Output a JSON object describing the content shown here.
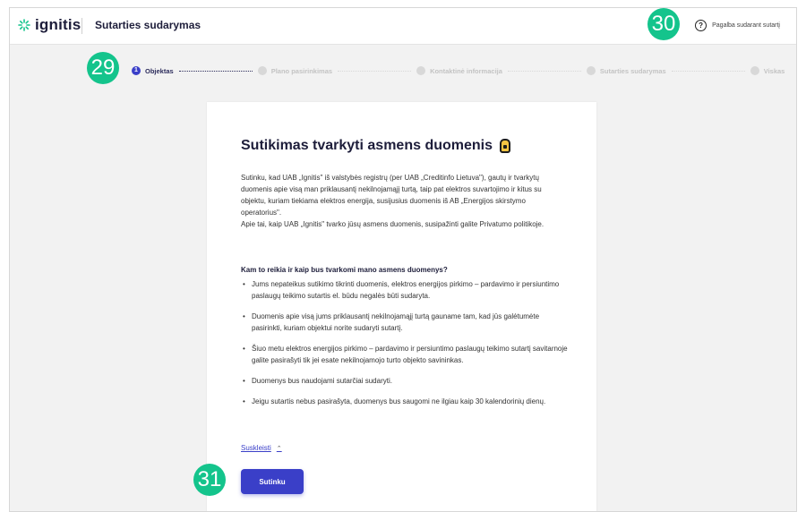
{
  "header": {
    "logo_text": "ignitis",
    "title": "Sutarties sudarymas",
    "help_label": "Pagalba sudarant sutartį",
    "help_icon": "question-circle-icon"
  },
  "markers": [
    "29",
    "30",
    "31"
  ],
  "stepper": {
    "steps": [
      {
        "number": "1",
        "label": "Objektas",
        "active": true
      },
      {
        "label": "Plano pasirinkimas"
      },
      {
        "label": "Kontaktinė informacija"
      },
      {
        "label": "Sutarties sudarymas"
      },
      {
        "label": "Viskas"
      }
    ]
  },
  "card": {
    "title": "Sutikimas tvarkyti asmens duomenis",
    "title_icon": "lock-icon",
    "paragraph": "Sutinku, kad UAB „Ignitis\" iš valstybės registrų (per UAB „Creditinfo Lietuva\"), gautų ir tvarkytų duomenis apie visą man priklausantį nekilnojamąjį turtą, taip pat elektros suvartojimo ir kitus su objektu, kuriam tiekiama elektros energija, susijusius duomenis iš AB „Energijos skirstymo operatorius\".",
    "paragraph2": "Apie tai, kaip UAB „Ignitis\" tvarko jūsų asmens duomenis, susipažinti galite Privatumo politikoje.",
    "subheading": "Kam to reikia ir kaip bus tvarkomi mano asmens duomenys?",
    "bullets": [
      "Jums nepateikus sutikimo tikrinti duomenis, elektros energijos pirkimo – pardavimo ir persiuntimo paslaugų teikimo sutartis el. būdu negalės būti sudaryta.",
      "Duomenis apie visą jums priklausantį nekilnojamąjį turtą gauname tam, kad jūs galėtumėte pasirinkti, kuriam objektui norite sudaryti sutartį.",
      "Šiuo metu elektros energijos pirkimo – pardavimo ir persiuntimo paslaugų teikimo sutartį savitarnoje galite pasirašyti tik jei esate nekilnojamojo turto objekto savininkas.",
      "Duomenys bus naudojami sutarčiai sudaryti.",
      "Jeigu sutartis nebus pasirašyta, duomenys bus saugomi ne ilgiau kaip 30 kalendorinių dienų."
    ],
    "collapse_label": "Suskleisti",
    "agree_label": "Sutinku"
  },
  "colors": {
    "accent": "#3a3fc8",
    "marker": "#14c48c",
    "lock": "#f5c542"
  }
}
